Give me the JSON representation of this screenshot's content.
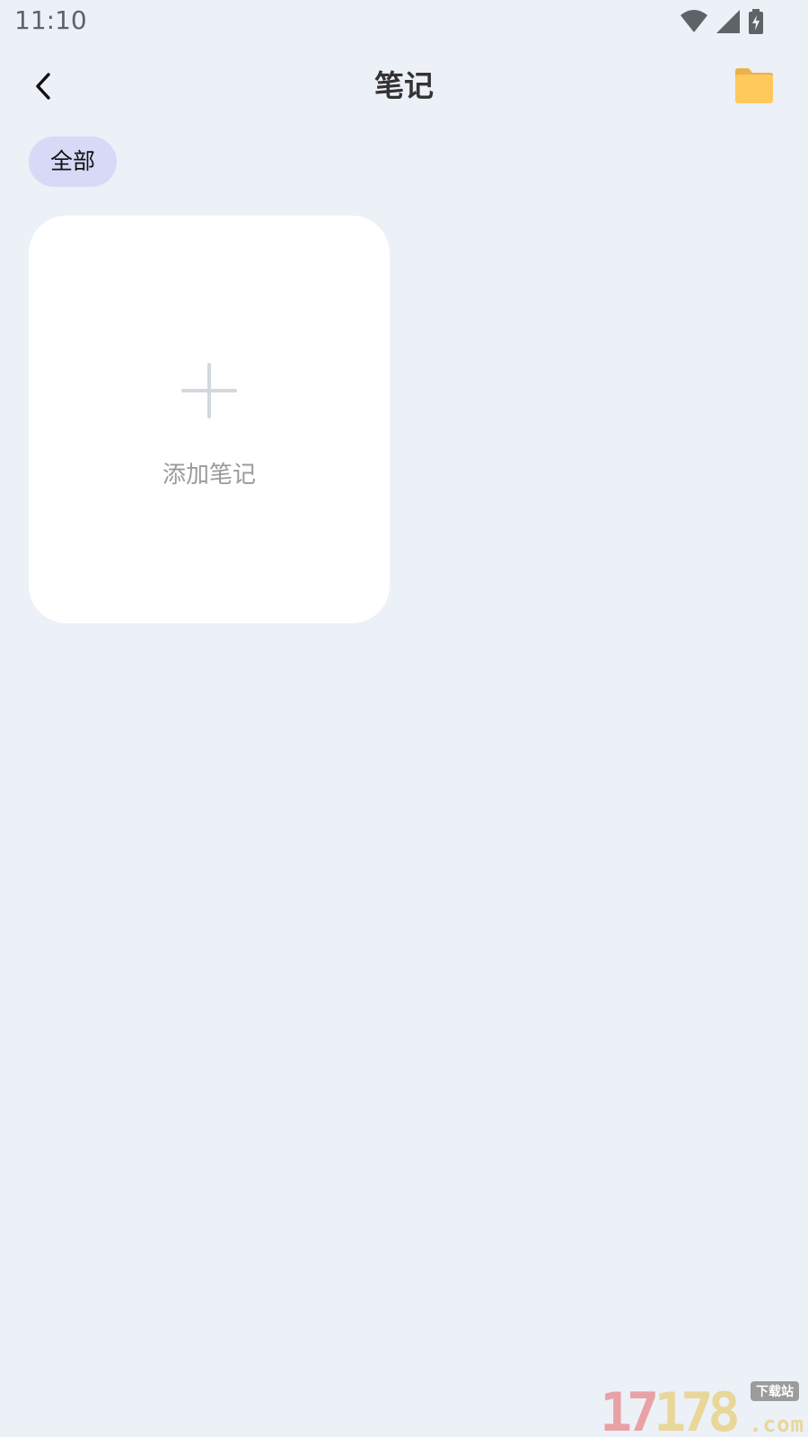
{
  "status_bar": {
    "time": "11:10",
    "icons": [
      "wifi-icon",
      "cell-signal-icon",
      "battery-charging-icon"
    ]
  },
  "header": {
    "title": "笔记",
    "back_icon": "chevron-left-icon",
    "folder_icon": "folder-icon"
  },
  "categories": [
    {
      "label": "全部",
      "selected": true
    }
  ],
  "add_card": {
    "label": "添加笔记",
    "icon": "plus-icon"
  },
  "watermark": {
    "digits_a": "17",
    "digits_b": "178",
    "sub": "下载站",
    "suffix": ".com"
  },
  "colors": {
    "background": "#ECF0F7",
    "chip_selected": "#D8D9F7",
    "card": "#FFFFFF",
    "folder": "#FFC95C"
  }
}
